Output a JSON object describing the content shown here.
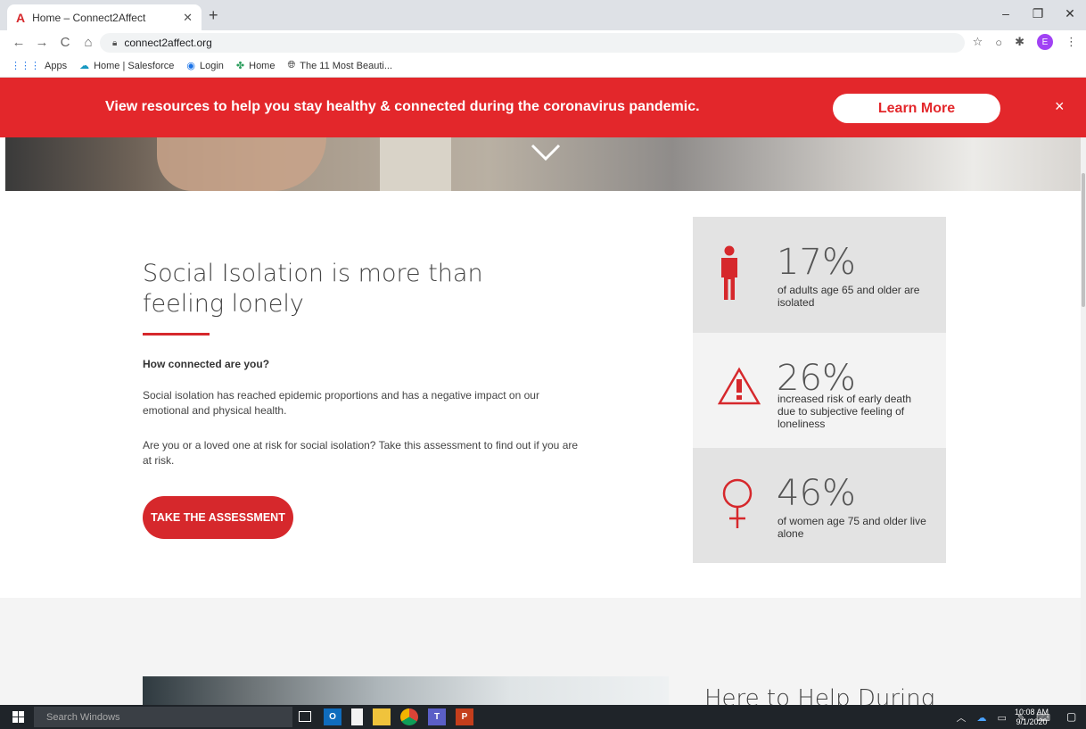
{
  "browser": {
    "tab_title": "Home – Connect2Affect",
    "url": "connect2affect.org",
    "bookmarks": [
      "Apps",
      "Home | Salesforce",
      "Login",
      "Home",
      "The 11 Most Beauti..."
    ]
  },
  "banner": {
    "text": "View resources to help you stay healthy & connected during the coronavirus pandemic.",
    "button": "Learn More",
    "close": "×"
  },
  "main": {
    "title": "Social Isolation is more than feeling lonely",
    "subhead": "How connected are you?",
    "para1": "Social isolation has reached epidemic proportions and has a negative impact on our emotional and physical health.",
    "para2": "Are you or a loved one at risk for social isolation? Take this assessment to find out if you are at risk.",
    "cta": "TAKE THE ASSESSMENT"
  },
  "stats": [
    {
      "value": "17%",
      "desc": "of adults age 65 and older are isolated",
      "icon": "person-icon"
    },
    {
      "value": "26%",
      "desc": "increased risk of early death due to subjective feeling of loneliness",
      "icon": "warning-icon"
    },
    {
      "value": "46%",
      "desc": "of women age 75 and older live alone",
      "icon": "female-icon"
    }
  ],
  "lower": {
    "heading": "Here to Help During"
  },
  "taskbar": {
    "search": "Search Windows",
    "time": "10:08 AM",
    "date": "9/1/2020"
  },
  "colors": {
    "brand_red": "#e3272b",
    "cta_red": "#d6282c",
    "stat_bg": "#e3e3e3"
  }
}
